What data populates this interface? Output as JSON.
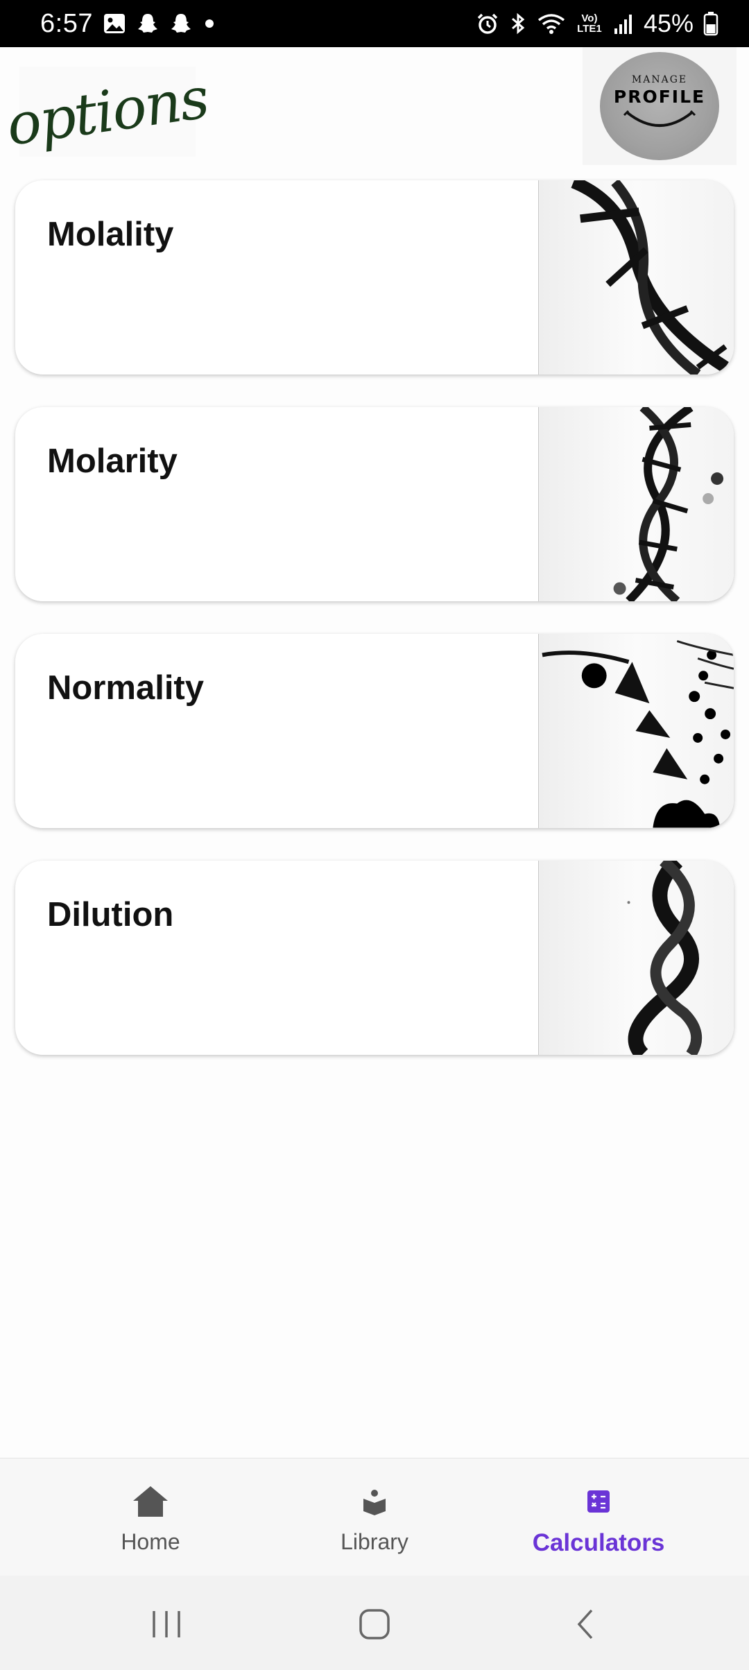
{
  "status_bar": {
    "time": "6:57",
    "battery": "45%",
    "icons_left": [
      "gallery-icon",
      "snapchat-icon",
      "snapchat-icon",
      "dot-icon"
    ],
    "icons_right": [
      "alarm-icon",
      "bluetooth-icon",
      "wifi-icon",
      "volte-icon",
      "signal-icon",
      "battery-icon"
    ],
    "volte_text": "Vo) LTE1"
  },
  "header": {
    "logo_text": "options",
    "profile_top": "MANAGE",
    "profile_label": "PROFILE"
  },
  "cards": [
    {
      "title": "Molality"
    },
    {
      "title": "Molarity"
    },
    {
      "title": "Normality"
    },
    {
      "title": "Dilution"
    }
  ],
  "bottom_nav": {
    "items": [
      {
        "label": "Home",
        "icon": "home-icon"
      },
      {
        "label": "Library",
        "icon": "library-icon"
      },
      {
        "label": "Calculators",
        "icon": "calculator-icon"
      }
    ],
    "active": "Calculators"
  },
  "colors": {
    "accent": "#6a34d6",
    "nav_inactive": "#555555",
    "logo_green": "#1a3a1a"
  }
}
